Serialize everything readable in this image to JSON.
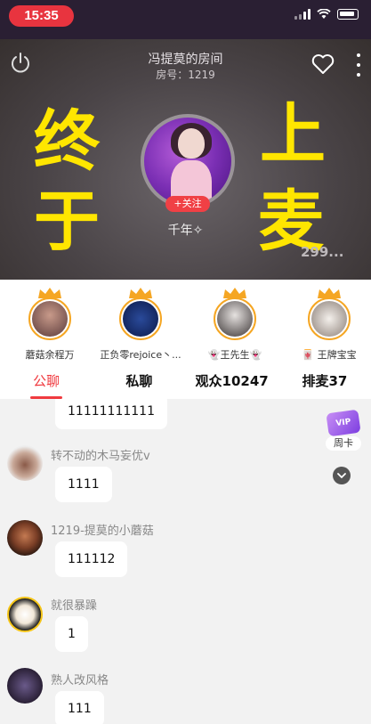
{
  "status_bar": {
    "time": "15:35"
  },
  "room": {
    "title": "冯提莫的房间",
    "room_no": "房号：1219",
    "host_name": "千年✧",
    "follow_label": "+关注",
    "viewer_count": "299...",
    "overlay_left": [
      "终",
      "于"
    ],
    "overlay_right": [
      "上",
      "麦"
    ]
  },
  "seats": [
    {
      "label": "蘑菇余程万"
    },
    {
      "label": "正负零rejoice丶..."
    },
    {
      "label": "👻王先生👻"
    },
    {
      "label": "🀄 王牌宝宝"
    }
  ],
  "tabs": [
    {
      "label": "公聊",
      "active": true
    },
    {
      "label": "私聊"
    },
    {
      "label": "观众10247"
    },
    {
      "label": "排麦37"
    }
  ],
  "vip": {
    "badge": "VIP",
    "label": "周卡"
  },
  "chat": [
    {
      "user": "",
      "text": "11111111111"
    },
    {
      "user": "转不动的木马妄优v",
      "text": "1111"
    },
    {
      "user": "1219-提莫的小蘑菇",
      "text": "111112"
    },
    {
      "user": "就很暴躁",
      "text": "1"
    },
    {
      "user": "熟人改风格",
      "text": "111"
    }
  ],
  "colors": {
    "accent": "#f03a3f",
    "overlay_text": "#ffe600"
  }
}
